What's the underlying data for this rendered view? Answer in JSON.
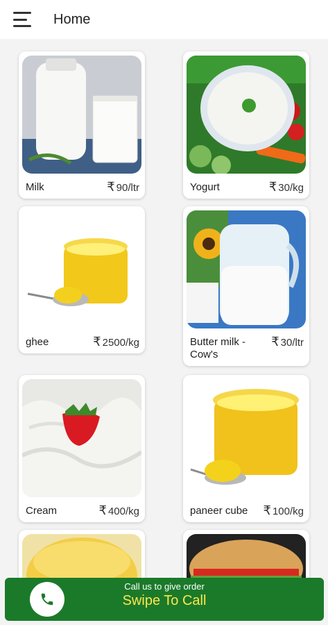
{
  "app_bar": {
    "title": "Home"
  },
  "products": [
    {
      "name": "Milk",
      "currency": "₹",
      "price": "90/ltr"
    },
    {
      "name": "Yogurt",
      "currency": "₹",
      "price": "30/kg"
    },
    {
      "name": "ghee",
      "currency": "₹",
      "price": "2500/kg"
    },
    {
      "name": "Butter milk - Cow's",
      "currency": "₹",
      "price": "30/ltr"
    },
    {
      "name": "Cream",
      "currency": "₹",
      "price": "400/kg"
    },
    {
      "name": "paneer cube",
      "currency": "₹",
      "price": "100/kg"
    },
    {
      "name": "",
      "currency": "",
      "price": ""
    },
    {
      "name": "",
      "currency": "",
      "price": ""
    }
  ],
  "call_bar": {
    "subtitle": "Call us to give order",
    "action": "Swipe To Call",
    "accent_color": "#1b7a2a",
    "action_color": "#ffe64d",
    "icon": "phone-icon"
  }
}
